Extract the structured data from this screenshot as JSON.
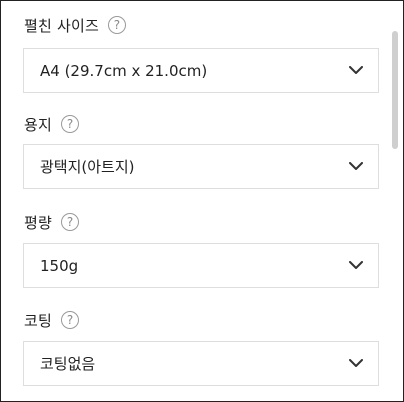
{
  "fields": [
    {
      "label": "펼친 사이즈",
      "help_icon": "question-circle-icon",
      "help_glyph": "?",
      "value": "A4 (29.7cm x 21.0cm)",
      "chevron_icon": "chevron-down-icon"
    },
    {
      "label": "용지",
      "help_icon": "question-circle-icon",
      "help_glyph": "?",
      "value": "광택지(아트지)",
      "chevron_icon": "chevron-down-icon"
    },
    {
      "label": "평량",
      "help_icon": "question-circle-icon",
      "help_glyph": "?",
      "value": "150g",
      "chevron_icon": "chevron-down-icon"
    },
    {
      "label": "코팅",
      "help_icon": "question-circle-icon",
      "help_glyph": "?",
      "value": "코팅없음",
      "chevron_icon": "chevron-down-icon"
    }
  ],
  "scrollbar": {
    "position_fraction": 0.0
  }
}
